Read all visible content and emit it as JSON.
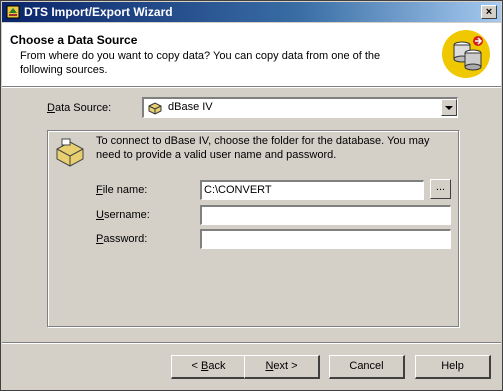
{
  "window": {
    "title": "DTS Import/Export Wizard",
    "close_glyph": "×"
  },
  "header": {
    "title": "Choose a Data Source",
    "description": "From where do you want to copy data?  You can copy data from one of the following sources."
  },
  "data_source": {
    "label_prefix": "",
    "label_access": "D",
    "label_rest": "ata Source:",
    "value": "dBase IV"
  },
  "group": {
    "description": "To connect to dBase IV, choose the folder for the database.  You may need to provide a valid user name and password."
  },
  "fields": {
    "file_name": {
      "label_access": "F",
      "label_rest": "ile name:",
      "value": "C:\\CONVERT"
    },
    "username": {
      "label_access": "U",
      "label_rest": "sername:",
      "value": ""
    },
    "password": {
      "label_access": "P",
      "label_rest": "assword:",
      "value": ""
    },
    "browse_label": "..."
  },
  "buttons": {
    "back": {
      "prefix": "< ",
      "access": "B",
      "rest": "ack"
    },
    "next": {
      "prefix": "",
      "access": "N",
      "rest": "ext >"
    },
    "cancel": "Cancel",
    "help": "Help"
  }
}
